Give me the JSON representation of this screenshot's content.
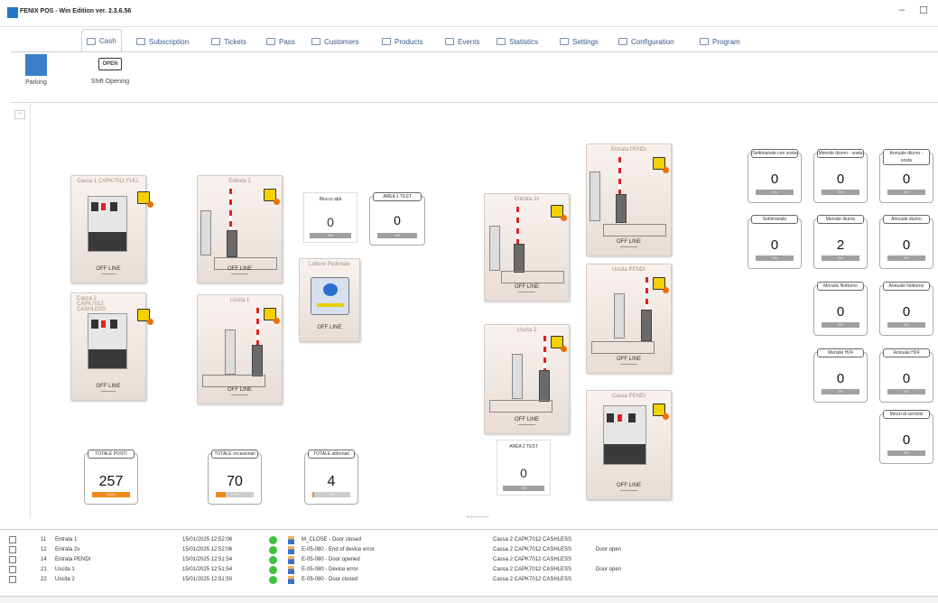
{
  "app": {
    "title": "FENIX POS - Win Edition ver. 2.3.6.56",
    "min_glyph": "–",
    "max_glyph": "☐"
  },
  "tabs": [
    {
      "label": "Cash",
      "active": true,
      "icon": "cash-register-icon"
    },
    {
      "label": "Subscription",
      "icon": "subscription-icon"
    },
    {
      "label": "Tickets",
      "icon": "ticket-icon"
    },
    {
      "label": "Pass",
      "icon": "pass-icon"
    },
    {
      "label": "Customers",
      "icon": "customers-icon"
    },
    {
      "label": "Products",
      "icon": "products-icon"
    },
    {
      "label": "Events",
      "icon": "events-icon"
    },
    {
      "label": "Statistics",
      "icon": "statistics-icon"
    },
    {
      "label": "Settings",
      "icon": "settings-icon"
    },
    {
      "label": "Configuration",
      "icon": "configuration-icon"
    },
    {
      "label": "Program",
      "icon": "program-icon"
    }
  ],
  "ribbon": {
    "parking_label": "Parking",
    "shift_label": "Shift Opening",
    "open_sign": "OPEN"
  },
  "leftstrip": {
    "collapse": "−"
  },
  "devices": [
    {
      "name": "Cassa 1 CAPK7011 FULL",
      "status": "OFF LINE"
    },
    {
      "name": "Cassa 2 CAPK7012 CASHLESS",
      "status": "OFF LINE"
    },
    {
      "name": "Entrata 1",
      "status": "OFF LINE"
    },
    {
      "name": "Uscita 1",
      "status": "OFF LINE"
    },
    {
      "name": "Lettore Pedonale",
      "status": "OFF LINE"
    },
    {
      "name": "Entrata 2x",
      "status": "OFF LINE"
    },
    {
      "name": "Uscita 2",
      "status": "OFF LINE"
    },
    {
      "name": "Entrata PENDI",
      "status": "OFF LINE"
    },
    {
      "name": "Uscita PENDI",
      "status": "OFF LINE"
    },
    {
      "name": "Cassa PENDI",
      "status": "OFF LINE"
    }
  ],
  "counters": {
    "blocco": {
      "label": "Blocco abb",
      "value": "0",
      "pct": "0%"
    },
    "area1": {
      "label": "AREA 1 TEST",
      "value": "0",
      "pct": "0%"
    },
    "area2": {
      "label": "AREA 2 TEST",
      "value": "0",
      "pct": "0%"
    },
    "totale_posti": {
      "label": "TOTALE POSTI",
      "value": "257",
      "pct": "100%",
      "fill": 1.0
    },
    "totale_occ": {
      "label": "TOTALE occasionali",
      "value": "70",
      "pct": "27%",
      "fill": 0.27
    },
    "totale_abb": {
      "label": "TOTALE abbonati",
      "value": "4",
      "pct": "4%",
      "fill": 0.04
    },
    "sett_sosta": {
      "label": "Settimanale con sosta",
      "value": "0",
      "pct": "0%"
    },
    "mensile_diurno_sosta": {
      "label": "Mensile diurno - sosta",
      "value": "0",
      "pct": "0%"
    },
    "annuale_diurno_sosta": {
      "label": "Annuale diurno - sosta",
      "value": "0",
      "pct": "0%"
    },
    "settimanale": {
      "label": "Settimanale",
      "value": "0",
      "pct": "0%"
    },
    "mensile_diurno": {
      "label": "Mensile diurno",
      "value": "2",
      "pct": "2%"
    },
    "annuale_diurno": {
      "label": "Annuale diurno",
      "value": "0",
      "pct": "0%"
    },
    "mensile_notturno": {
      "label": "Mensile Notturno",
      "value": "0",
      "pct": "0%"
    },
    "annuale_notturno": {
      "label": "Annuale Notturno",
      "value": "0",
      "pct": "0%"
    },
    "mensile_h24": {
      "label": "Mensile H24",
      "value": "0",
      "pct": "0%"
    },
    "annuale_h24": {
      "label": "Annuale H24",
      "value": "0",
      "pct": "0%"
    },
    "mezzi_servizio": {
      "label": "Mezzi di servizio",
      "value": "0",
      "pct": "0%"
    }
  },
  "log_devices": [
    {
      "id": "11",
      "name": "Entrata 1"
    },
    {
      "id": "12",
      "name": "Entrata 2x"
    },
    {
      "id": "14",
      "name": "Entrata PENDI"
    },
    {
      "id": "21",
      "name": "Uscita 1"
    },
    {
      "id": "22",
      "name": "Uscita 2"
    }
  ],
  "events": [
    {
      "time": "15/01/2025 12:52:06",
      "msg": "M_CLOSE - Door closed",
      "device": "Cassa 2 CAPK7012 CASHLESS",
      "note": ""
    },
    {
      "time": "15/01/2025 12:52:06",
      "msg": "E-05-080 - End of device error",
      "device": "Cassa 2 CAPK7012 CASHLESS",
      "note": "Door open"
    },
    {
      "time": "15/01/2025 12:51:54",
      "msg": "E-05-080 - Door opened",
      "device": "Cassa 2 CAPK7012 CASHLESS",
      "note": ""
    },
    {
      "time": "15/01/2025 12:51:54",
      "msg": "E-05-080 - Device error",
      "device": "Cassa 2 CAPK7012 CASHLESS",
      "note": "Door open"
    },
    {
      "time": "15/01/2025 12:51:50",
      "msg": "E-05-080 - Door closed",
      "device": "Cassa 2 CAPK7012 CASHLESS",
      "note": ""
    }
  ]
}
